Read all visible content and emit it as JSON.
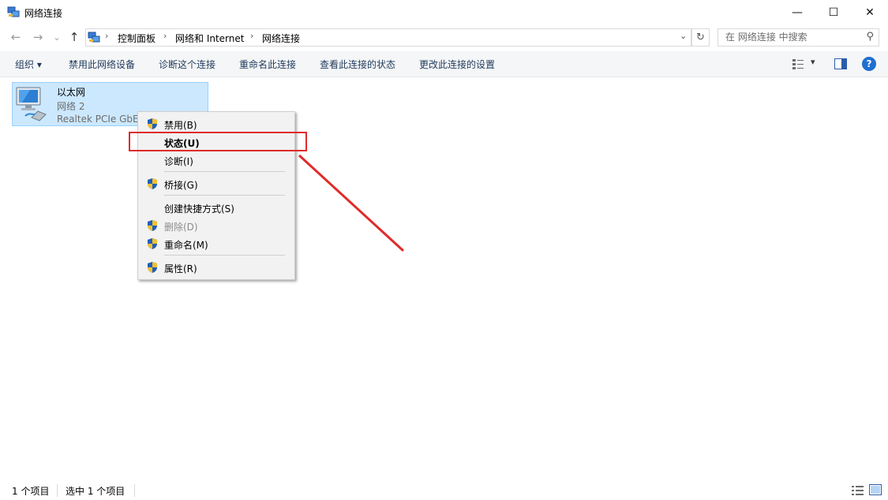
{
  "window": {
    "title": "网络连接",
    "icon": "network-connections-icon",
    "controls": {
      "minimize": "—",
      "maximize": "☐",
      "close": "✕"
    }
  },
  "nav": {
    "back": "←",
    "forward": "→",
    "recent": "⌄",
    "up": "↑"
  },
  "address": {
    "crumbs": [
      "控制面板",
      "网络和 Internet",
      "网络连接"
    ],
    "separator": "›",
    "dropdown": "⌄",
    "refresh": "↻"
  },
  "search": {
    "placeholder": "在 网络连接 中搜索",
    "icon": "⚲"
  },
  "commands": {
    "organize": "组织 ▾",
    "disable": "禁用此网络设备",
    "diagnose": "诊断这个连接",
    "rename": "重命名此连接",
    "view_status": "查看此连接的状态",
    "change_settings": "更改此连接的设置",
    "view_toggle": "▾",
    "help": "?"
  },
  "item": {
    "name": "以太网",
    "network": "网络 2",
    "adapter": "Realtek PCIe GbE"
  },
  "context_menu": {
    "items": [
      {
        "label": "禁用(B)",
        "shield": true,
        "disabled": false,
        "bold": false
      },
      {
        "label": "状态(U)",
        "shield": false,
        "disabled": false,
        "bold": true,
        "highlighted": true
      },
      {
        "label": "诊断(I)",
        "shield": false,
        "disabled": false,
        "bold": false
      },
      {
        "label": "桥接(G)",
        "shield": true,
        "disabled": false,
        "bold": false
      },
      {
        "label": "创建快捷方式(S)",
        "shield": false,
        "disabled": false,
        "bold": false
      },
      {
        "label": "删除(D)",
        "shield": true,
        "disabled": true,
        "bold": false
      },
      {
        "label": "重命名(M)",
        "shield": true,
        "disabled": false,
        "bold": false
      },
      {
        "label": "属性(R)",
        "shield": true,
        "disabled": false,
        "bold": false
      }
    ]
  },
  "annotation": {
    "color": "#e02b2b"
  },
  "status": {
    "count": "1 个项目",
    "selected": "选中 1 个项目"
  },
  "colors": {
    "selection_bg": "#cce8ff",
    "selection_border": "#99d1ff",
    "command_text": "#1e395b",
    "help_blue": "#1f6fd0"
  }
}
